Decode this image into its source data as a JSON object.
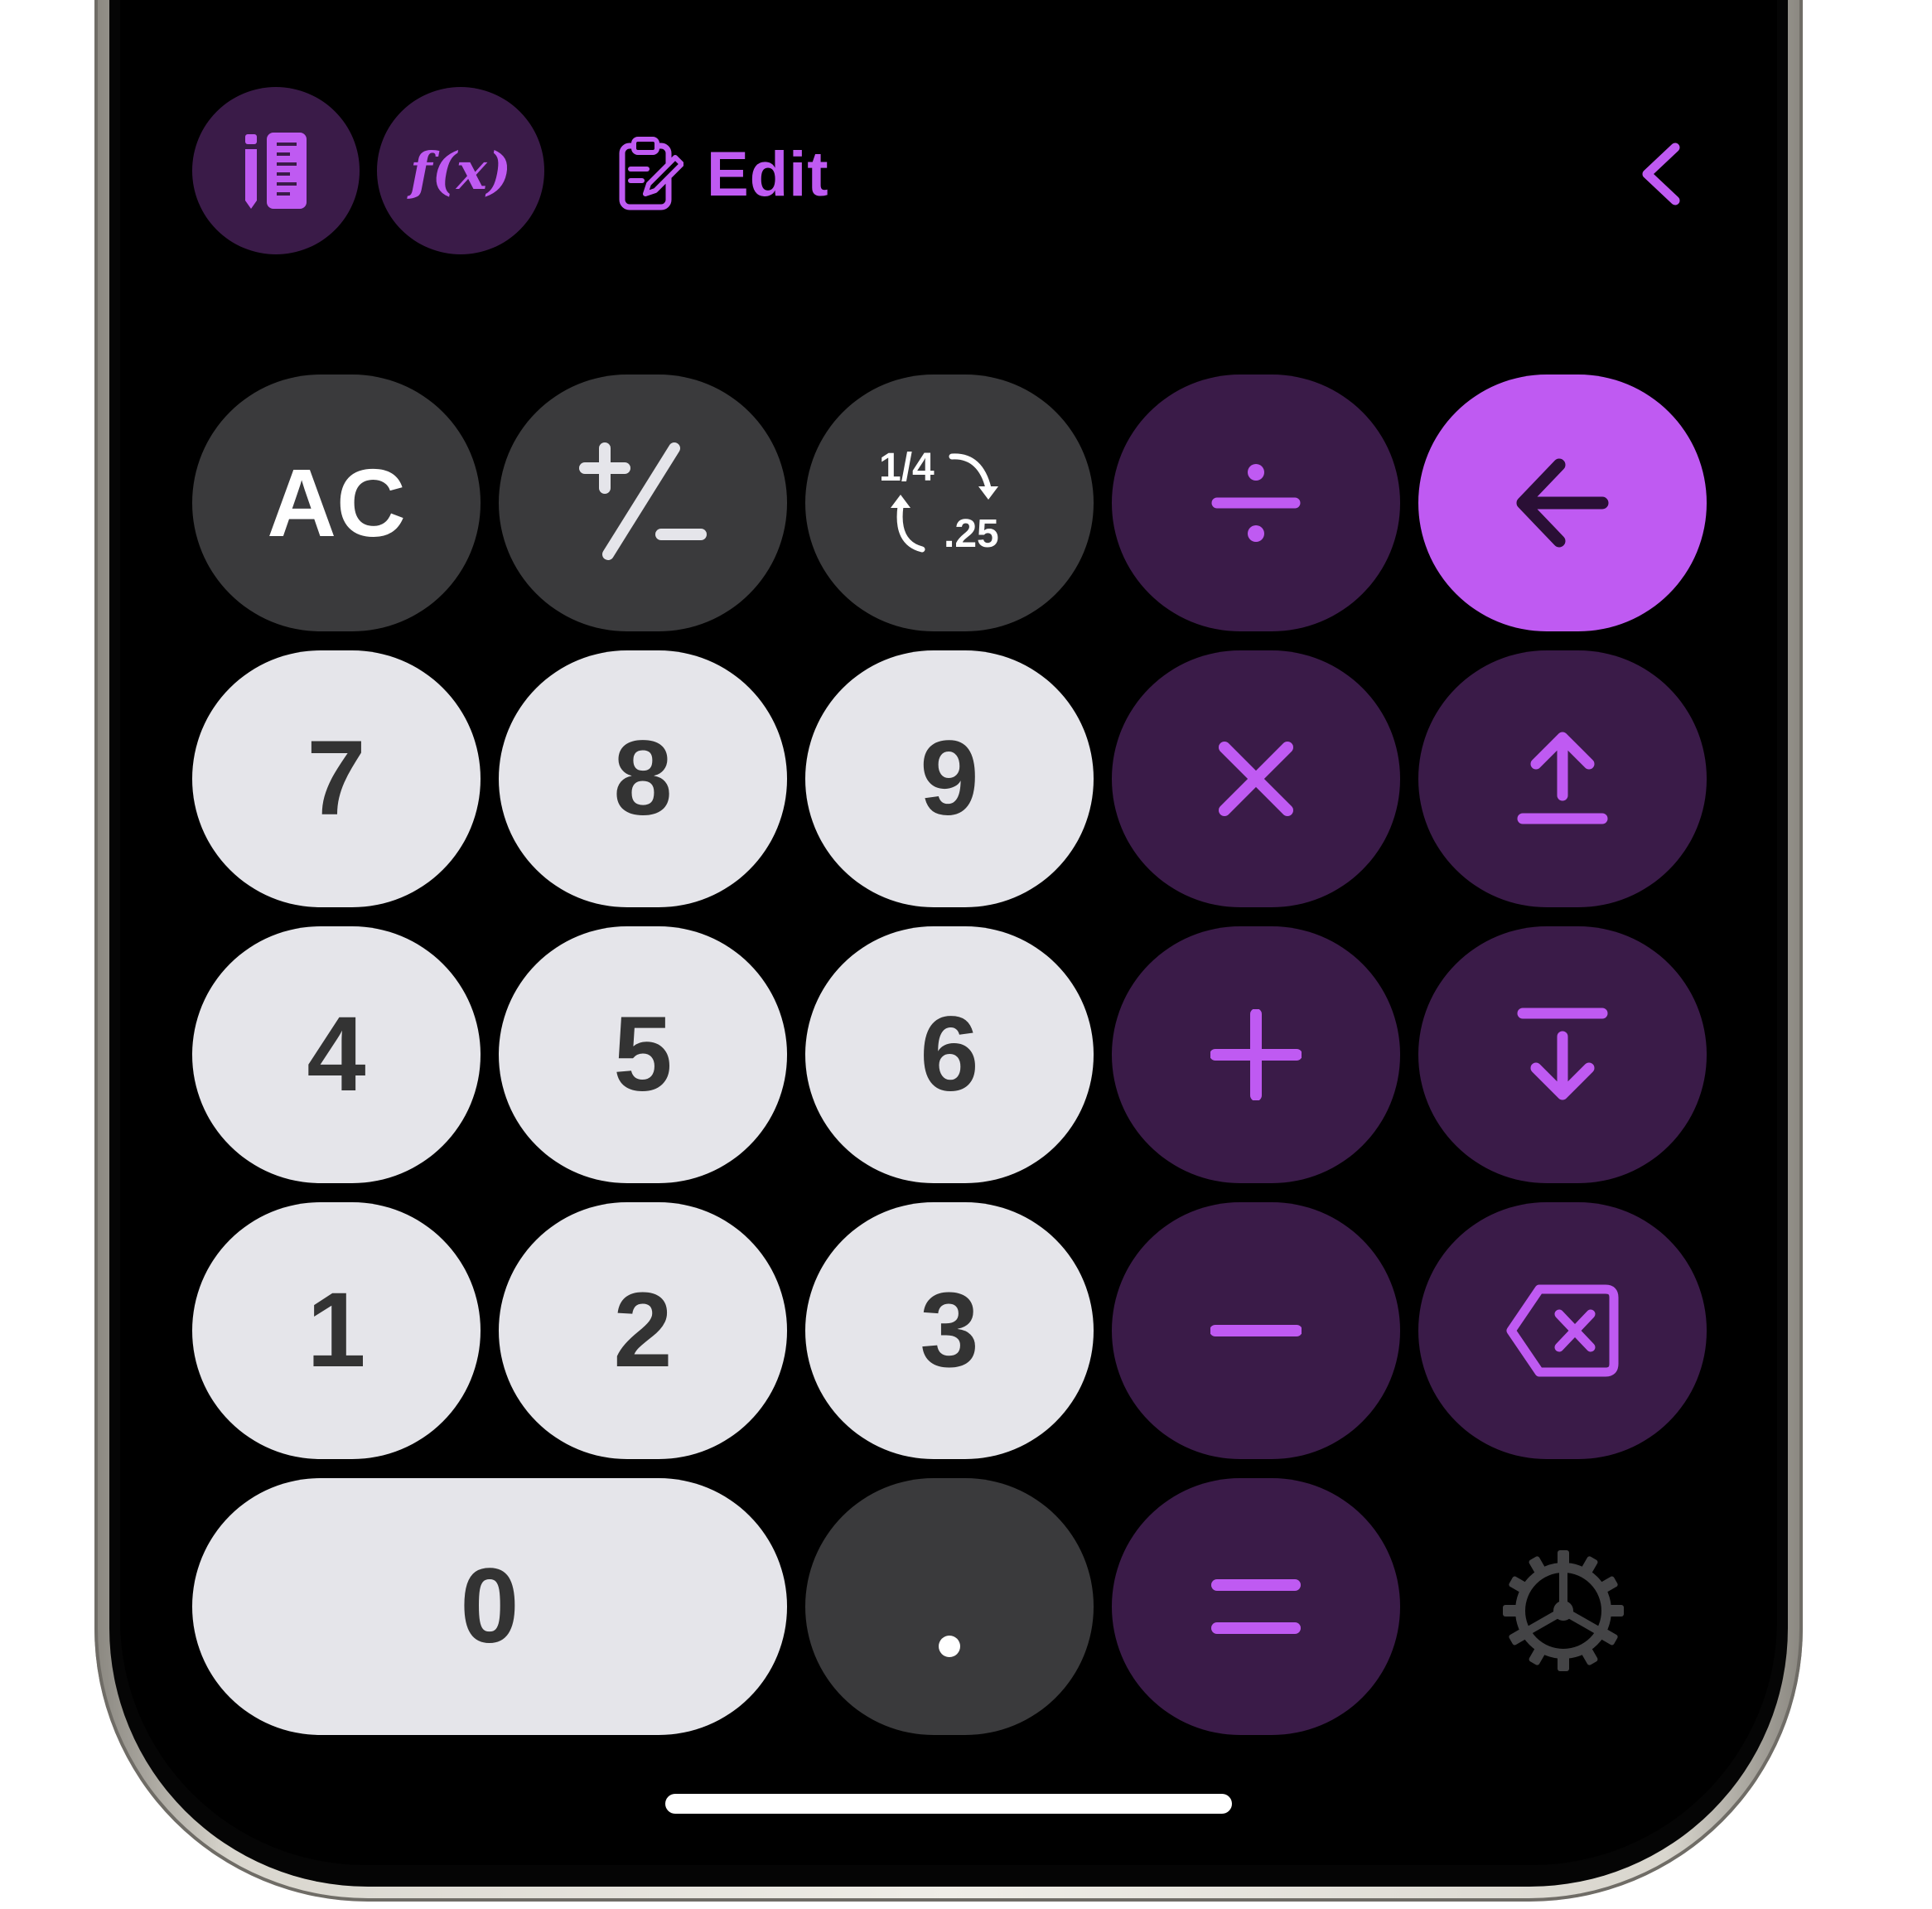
{
  "toolbar": {
    "units_icon": "ruler-pencil-icon",
    "functions_label": "f(x)",
    "edit_icon": "clipboard-edit-icon",
    "edit_label": "Edit",
    "back_icon": "chevron-left-icon"
  },
  "keypad": {
    "clear": "AC",
    "sign_toggle_icon": "plus-minus-icon",
    "fraction_top": "1/4",
    "fraction_bottom": ".25",
    "divide_icon": "divide-icon",
    "enter_icon": "arrow-left-icon",
    "multiply_icon": "multiply-icon",
    "push_up_icon": "arrow-up-bar-icon",
    "add_icon": "plus-icon",
    "push_down_icon": "arrow-down-bar-icon",
    "subtract_icon": "minus-icon",
    "backspace_icon": "backspace-icon",
    "equals_icon": "equals-icon",
    "settings_icon": "gear-icon",
    "digits": {
      "d7": "7",
      "d8": "8",
      "d9": "9",
      "d4": "4",
      "d5": "5",
      "d6": "6",
      "d1": "1",
      "d2": "2",
      "d3": "3",
      "d0": "0"
    },
    "decimal": "."
  },
  "colors": {
    "accent": "#bf5af2",
    "operator_bg": "#3a1b48",
    "function_bg": "#3a3a3c",
    "digit_bg": "#e5e5ea",
    "screen_bg": "#000000"
  }
}
